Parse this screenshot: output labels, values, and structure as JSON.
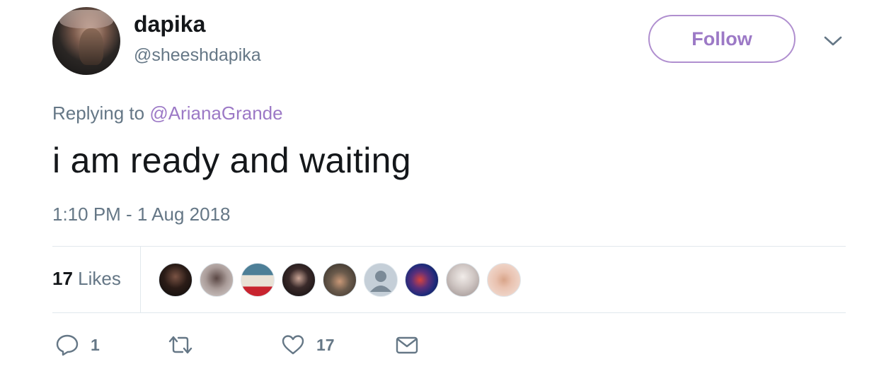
{
  "user": {
    "display_name": "dapika",
    "handle": "@sheeshdapika"
  },
  "header": {
    "follow_label": "Follow",
    "menu_icon": "chevron-down-icon"
  },
  "reply_context": {
    "prefix": "Replying to",
    "mention": "@ArianaGrande"
  },
  "tweet": {
    "text": "i am ready and waiting",
    "timestamp": "1:10 PM - 1 Aug 2018"
  },
  "stats": {
    "likes_count": "17",
    "likes_label": "Likes"
  },
  "likers": [
    {
      "name": "liker-1"
    },
    {
      "name": "liker-2"
    },
    {
      "name": "liker-3"
    },
    {
      "name": "liker-4"
    },
    {
      "name": "liker-5"
    },
    {
      "name": "liker-6"
    },
    {
      "name": "liker-7"
    },
    {
      "name": "liker-8"
    },
    {
      "name": "liker-9"
    }
  ],
  "actions": {
    "reply_count": "1",
    "retweet_count": "",
    "like_count": "17",
    "icons": [
      "reply-icon",
      "retweet-icon",
      "like-icon",
      "direct-message-icon"
    ]
  },
  "colors": {
    "accent": "#9c79c6",
    "muted_text": "#657786",
    "primary_text": "#14171a",
    "divider": "#e1e8ed"
  }
}
